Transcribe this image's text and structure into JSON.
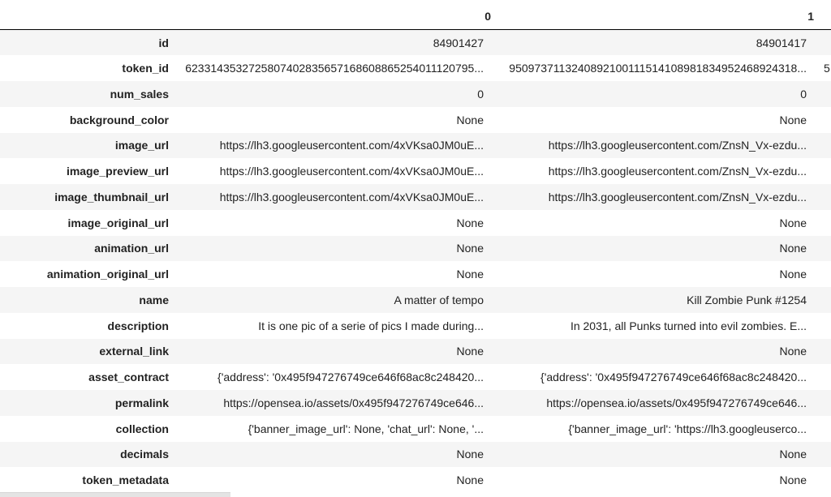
{
  "table": {
    "columns": [
      "0",
      "1",
      ""
    ],
    "rows": [
      {
        "key": "id",
        "values": [
          "84901427",
          "84901417",
          ""
        ]
      },
      {
        "key": "token_id",
        "values": [
          "6233143532725807402835657168608865254011120795...",
          "9509737113240892100111514108981834952468924318...",
          "5"
        ]
      },
      {
        "key": "num_sales",
        "values": [
          "0",
          "0",
          ""
        ]
      },
      {
        "key": "background_color",
        "values": [
          "None",
          "None",
          ""
        ]
      },
      {
        "key": "image_url",
        "values": [
          "https://lh3.googleusercontent.com/4xVKsa0JM0uE...",
          "https://lh3.googleusercontent.com/ZnsN_Vx-ezdu...",
          ""
        ]
      },
      {
        "key": "image_preview_url",
        "values": [
          "https://lh3.googleusercontent.com/4xVKsa0JM0uE...",
          "https://lh3.googleusercontent.com/ZnsN_Vx-ezdu...",
          ""
        ]
      },
      {
        "key": "image_thumbnail_url",
        "values": [
          "https://lh3.googleusercontent.com/4xVKsa0JM0uE...",
          "https://lh3.googleusercontent.com/ZnsN_Vx-ezdu...",
          ""
        ]
      },
      {
        "key": "image_original_url",
        "values": [
          "None",
          "None",
          ""
        ]
      },
      {
        "key": "animation_url",
        "values": [
          "None",
          "None",
          ""
        ]
      },
      {
        "key": "animation_original_url",
        "values": [
          "None",
          "None",
          ""
        ]
      },
      {
        "key": "name",
        "values": [
          "A matter of tempo",
          "Kill Zombie Punk #1254",
          ""
        ]
      },
      {
        "key": "description",
        "values": [
          "It is one pic of a serie of pics I made during...",
          "In 2031, all Punks turned into evil zombies. E...",
          ""
        ]
      },
      {
        "key": "external_link",
        "values": [
          "None",
          "None",
          ""
        ]
      },
      {
        "key": "asset_contract",
        "values": [
          "{'address': '0x495f947276749ce646f68ac8c248420...",
          "{'address': '0x495f947276749ce646f68ac8c248420...",
          ""
        ]
      },
      {
        "key": "permalink",
        "values": [
          "https://opensea.io/assets/0x495f947276749ce646...",
          "https://opensea.io/assets/0x495f947276749ce646...",
          ""
        ]
      },
      {
        "key": "collection",
        "values": [
          "{'banner_image_url': None, 'chat_url': None, '...",
          "{'banner_image_url': 'https://lh3.googleuserco...",
          ""
        ]
      },
      {
        "key": "decimals",
        "values": [
          "None",
          "None",
          ""
        ]
      },
      {
        "key": "token_metadata",
        "values": [
          "None",
          "None",
          ""
        ]
      }
    ]
  },
  "colors": {
    "stripe": "#f5f5f5",
    "header_rule": "#000000",
    "text": "#222222"
  }
}
